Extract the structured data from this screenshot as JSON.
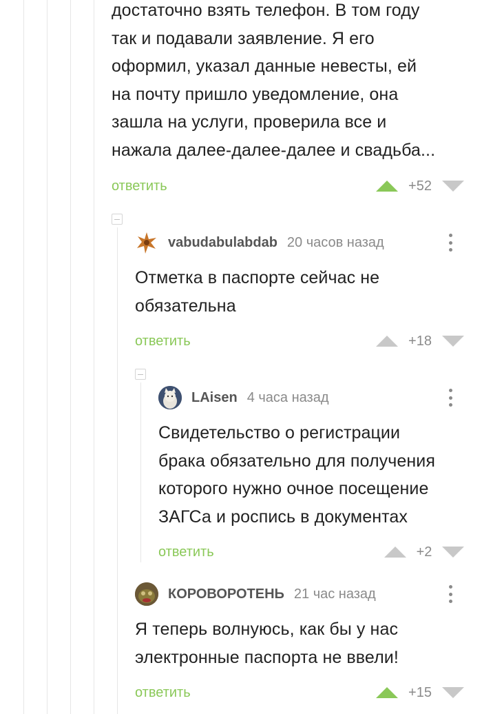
{
  "top_comment": {
    "text": "достаточно взять телефон. В том году\nтак и подавали заявление. Я его\nоформил, указал данные невесты, ей\nна почту пришло уведомление, она\nзашла на услуги, проверила все и\nнажала далее-далее-далее и свадьба...",
    "reply_label": "ответить",
    "score": "+52"
  },
  "comment_1": {
    "username": "vabudabulabdab",
    "time": "20 часов назад",
    "text": "Отметка в паспорте сейчас не\nобязательна",
    "reply_label": "ответить",
    "score": "+18"
  },
  "comment_2": {
    "username": "LAisen",
    "time": "4 часа назад",
    "text": "Свидетельство о регистрации\nбрака обязательно для получения\nкоторого нужно очное посещение\nЗАГСа и роспись в документах",
    "reply_label": "ответить",
    "score": "+2"
  },
  "comment_3": {
    "username": "КОРОВОРОТЕНЬ",
    "time": "21 час назад",
    "text": "Я теперь волнуюсь, как бы у нас\nэлектронные паспорта не ввели!",
    "reply_label": "ответить",
    "score": "+15"
  },
  "colors": {
    "accent_green": "#8ac858",
    "muted_gray": "#8a8a8a",
    "thread_line": "#e6e6e6"
  },
  "icons": [
    "collapse-icon",
    "upvote-icon",
    "downvote-icon",
    "more-options-icon"
  ]
}
